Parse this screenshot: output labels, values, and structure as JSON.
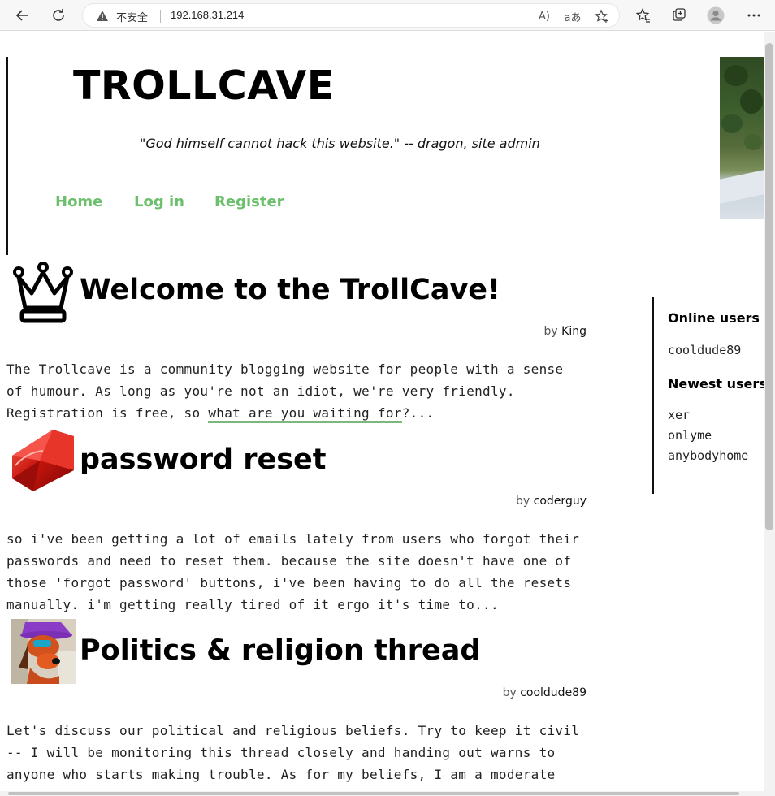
{
  "browser": {
    "security_label": "不安全",
    "url": "192.168.31.214",
    "icons": [
      "back-icon",
      "refresh-icon",
      "warning-icon",
      "read-aloud-icon",
      "translate-icon",
      "add-favorite-icon",
      "favorites-icon",
      "collections-icon",
      "profile-icon",
      "more-icon"
    ]
  },
  "site": {
    "title": "TROLLCAVE",
    "motto": "\"God himself cannot hack this website.\" -- dragon, site admin",
    "nav": [
      {
        "label": "Home"
      },
      {
        "label": "Log in"
      },
      {
        "label": "Register"
      }
    ]
  },
  "posts": [
    {
      "title": "Welcome to the TrollCave!",
      "by": "by",
      "author": "King",
      "icon": "crown-icon",
      "body_before": "The Trollcave is a community blogging website for people with a sense of humour. As long as you're not an idiot, we're very friendly. Registration is free, so ",
      "body_link": "what are you waiting for",
      "body_after": "?..."
    },
    {
      "title": "password reset",
      "by": "by",
      "author": "coderguy",
      "icon": "ruby-icon",
      "body": "so i've been getting a lot of emails lately from users who forgot their passwords and need to reset them. because the site doesn't have one of those 'forgot password' buttons, i've been having to do all the resets manually. i'm getting really tired of it ergo it's time to..."
    },
    {
      "title": "Politics & religion thread",
      "by": "by",
      "author": "cooldude89",
      "icon": "avatar-dog-icon",
      "body": "Let's discuss our political and religious beliefs. Try to keep it civil -- I will be monitoring this thread closely and handing out warns to anyone who starts making trouble. As for my beliefs, I am a moderate"
    }
  ],
  "sidebar": {
    "online_heading": "Online users",
    "online_users": [
      "cooldude89"
    ],
    "newest_heading": "Newest users",
    "newest_users": [
      "xer",
      "onlyme",
      "anybodyhome"
    ]
  },
  "colors": {
    "nav_link": "#6cbf6c",
    "link_underline": "#7cb87c"
  }
}
